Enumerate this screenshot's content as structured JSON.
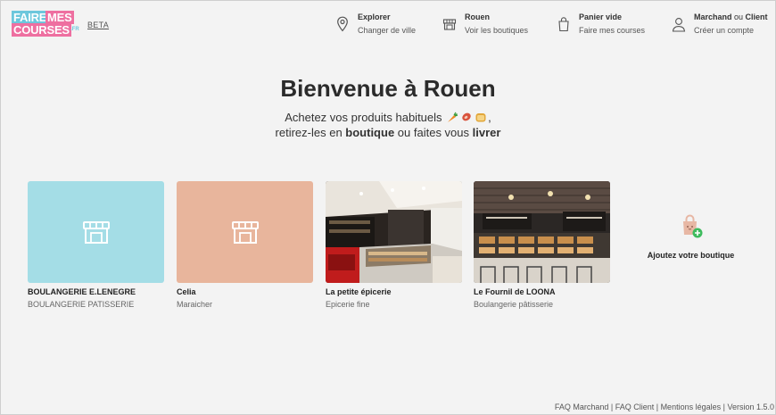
{
  "logo": {
    "word1": "FAIRE",
    "word2": "MES",
    "word3": "COURSES",
    "suffix": ".FR"
  },
  "beta": "BETA",
  "nav": {
    "explorer": {
      "title": "Explorer",
      "subtitle": "Changer de ville"
    },
    "city": {
      "title": "Rouen",
      "subtitle": "Voir les boutiques"
    },
    "cart": {
      "title": "Panier vide",
      "subtitle": "Faire mes courses"
    },
    "account": {
      "title_a": "Marchand",
      "title_or": " ou ",
      "title_b": "Client",
      "subtitle": "Créer un compte"
    }
  },
  "hero": {
    "title": "Bienvenue à Rouen",
    "line1": "Achetez vos produits habituels",
    "line1_end": ",",
    "line2_a": "retirez-les en ",
    "line2_b": "boutique",
    "line2_c": " ou faites vous ",
    "line2_d": "livrer"
  },
  "shops": [
    {
      "name": "BOULANGERIE E.LENEGRE",
      "category": "BOULANGERIE PATISSERIE",
      "bg": "#a4dde6"
    },
    {
      "name": "Celia",
      "category": "Maraicher",
      "bg": "#e8b59c"
    },
    {
      "name": "La petite épicerie",
      "category": "Epicerie fine"
    },
    {
      "name": "Le Fournil de LOONA",
      "category": "Boulangerie pâtisserie"
    }
  ],
  "add_shop": {
    "label": "Ajoutez votre boutique"
  },
  "footer": {
    "faq_merchant": "FAQ Marchand",
    "sep": " | ",
    "faq_client": "FAQ Client",
    "legal": "Mentions légales",
    "version": "Version 1.5.0"
  },
  "colors": {
    "brand_blue": "#6cc7dc",
    "brand_pink": "#ee6fa0",
    "add_green": "#3dbb5d"
  }
}
